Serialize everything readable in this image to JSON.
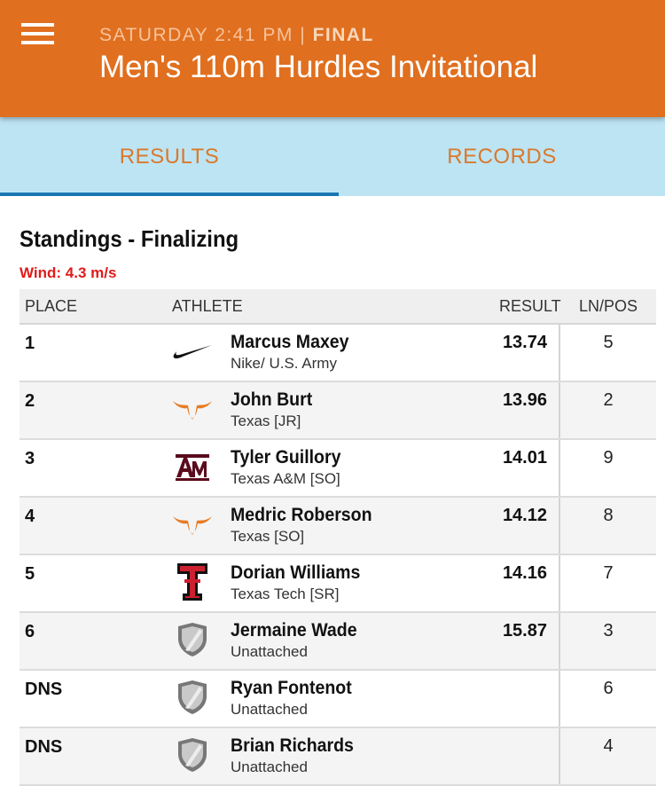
{
  "header": {
    "time": "SATURDAY 2:41 PM",
    "separator": "|",
    "status": "FINAL",
    "title": "Men's 110m Hurdles Invitational",
    "menu_icon": "hamburger-menu-icon",
    "background_color": "#e06f1f"
  },
  "tabs": [
    {
      "label": "RESULTS",
      "active": true
    },
    {
      "label": "RECORDS",
      "active": false
    }
  ],
  "standings": {
    "heading": "Standings - Finalizing",
    "wind": "Wind: 4.3 m/s",
    "columns": {
      "place": "PLACE",
      "athlete": "ATHLETE",
      "result": "RESULT",
      "lane": "LN/POS"
    },
    "rows": [
      {
        "place": "1",
        "logo": "nike-swoosh-logo",
        "name": "Marcus Maxey",
        "team": "Nike/ U.S. Army",
        "result": "13.74",
        "lane": "5"
      },
      {
        "place": "2",
        "logo": "texas-longhorn-logo",
        "name": "John Burt",
        "team": "Texas [JR]",
        "result": "13.96",
        "lane": "2"
      },
      {
        "place": "3",
        "logo": "texas-am-logo",
        "name": "Tyler Guillory",
        "team": "Texas A&M [SO]",
        "result": "14.01",
        "lane": "9"
      },
      {
        "place": "4",
        "logo": "texas-longhorn-logo",
        "name": "Medric Roberson",
        "team": "Texas [SO]",
        "result": "14.12",
        "lane": "8"
      },
      {
        "place": "5",
        "logo": "texas-tech-logo",
        "name": "Dorian Williams",
        "team": "Texas Tech [SR]",
        "result": "14.16",
        "lane": "7"
      },
      {
        "place": "6",
        "logo": "unattached-shield-logo",
        "name": "Jermaine Wade",
        "team": "Unattached",
        "result": "15.87",
        "lane": "3"
      },
      {
        "place": "DNS",
        "logo": "unattached-shield-logo",
        "name": "Ryan Fontenot",
        "team": "Unattached",
        "result": "",
        "lane": "6"
      },
      {
        "place": "DNS",
        "logo": "unattached-shield-logo",
        "name": "Brian Richards",
        "team": "Unattached",
        "result": "",
        "lane": "4"
      }
    ]
  }
}
